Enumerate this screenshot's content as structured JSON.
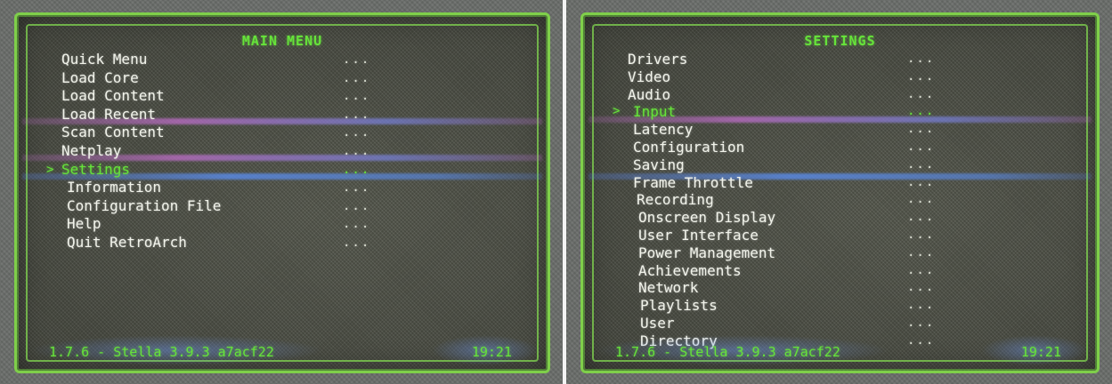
{
  "screens": [
    {
      "title": "MAIN MENU",
      "items": [
        {
          "label": "Quick Menu",
          "value": "..."
        },
        {
          "label": "Load Core",
          "value": "..."
        },
        {
          "label": "Load Content",
          "value": "..."
        },
        {
          "label": "Load Recent",
          "value": "..."
        },
        {
          "label": "Scan Content",
          "value": "..."
        },
        {
          "label": "Netplay",
          "value": "..."
        },
        {
          "label": "Settings",
          "value": "...",
          "selected": true
        },
        {
          "label": "Information",
          "value": "..."
        },
        {
          "label": "Configuration File",
          "value": "..."
        },
        {
          "label": "Help",
          "value": "..."
        },
        {
          "label": "Quit RetroArch",
          "value": "..."
        }
      ],
      "version": "1.7.6 - Stella 3.9.3 a7acf22",
      "clock": "19:21",
      "cursor": ">"
    },
    {
      "title": "SETTINGS",
      "items": [
        {
          "label": "Drivers",
          "value": "..."
        },
        {
          "label": "Video",
          "value": "..."
        },
        {
          "label": "Audio",
          "value": "..."
        },
        {
          "label": "Input",
          "value": "...",
          "selected": true
        },
        {
          "label": "Latency",
          "value": "..."
        },
        {
          "label": "Configuration",
          "value": "..."
        },
        {
          "label": "Saving",
          "value": "..."
        },
        {
          "label": "Frame Throttle",
          "value": "..."
        },
        {
          "label": "Recording",
          "value": "..."
        },
        {
          "label": "Onscreen Display",
          "value": "..."
        },
        {
          "label": "User Interface",
          "value": "..."
        },
        {
          "label": "Power Management",
          "value": "..."
        },
        {
          "label": "Achievements",
          "value": "..."
        },
        {
          "label": "Network",
          "value": "..."
        },
        {
          "label": "Playlists",
          "value": "..."
        },
        {
          "label": "User",
          "value": "..."
        },
        {
          "label": "Directory",
          "value": "..."
        }
      ],
      "version": "1.7.6 - Stella 3.9.3 a7acf22",
      "clock": "19:21",
      "cursor": ">"
    }
  ],
  "colors": {
    "accent_green": "#66e33a",
    "text_white": "#f1f3ea",
    "frame_green": "#7fcf4a",
    "interference_purple": "#be6ec8",
    "interference_blue": "#5a8ceb"
  }
}
